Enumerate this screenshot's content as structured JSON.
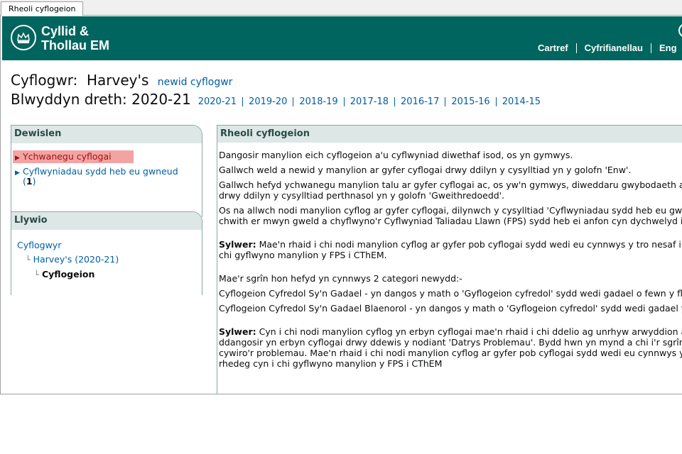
{
  "window": {
    "tab_title": "Rheoli cyflogeion"
  },
  "header": {
    "brand_line1": "Cyllid &",
    "brand_line2": "Thollau EM",
    "nav": [
      "Cartref",
      "Cyfrifianellau",
      "Eng"
    ]
  },
  "employer": {
    "label": "Cyflogwr:",
    "name": "Harvey's",
    "change_link": "newid cyflogwr"
  },
  "tax_year": {
    "label": "Blwyddyn dreth:",
    "current": "2020-21",
    "years": [
      "2020-21",
      "2019-20",
      "2018-19",
      "2017-18",
      "2016-17",
      "2015-16",
      "2014-15"
    ]
  },
  "menu": {
    "title": "Dewislen",
    "items": [
      {
        "label": "Ychwanegu cyflogai"
      },
      {
        "label": "Cyflwyniadau sydd heb eu gwneud",
        "count_open": "(",
        "count": "1",
        "count_close": ")"
      }
    ]
  },
  "navigation": {
    "title": "Llywio",
    "crumbs": [
      "Cyflogwyr",
      "Harvey's (2020-21)",
      "Cyflogeion"
    ]
  },
  "main": {
    "title": "Rheoli cyflogeion",
    "p1": "Dangosir manylion eich cyflogeion a'u cyflwyniad diwethaf isod, os yn gymwys.",
    "p2": "Gallwch weld a newid y manylion ar gyfer cyflogai drwy ddilyn y cysylltiad yn y golofn 'Enw'.",
    "p3a": "Gallwch hefyd ychwanegu manylion talu ar gyfer cyflogai ac, os yw'n gymwys, diweddaru gwybodaeth am",
    "p3b": "drwy ddilyn y cysylltiad perthnasol yn y golofn 'Gweithredoedd'.",
    "p4a": "Os na allwch nodi manylion cyflog ar gyfer cyflogai, dilynwch y cysylltiad 'Cyflwyniadau sydd heb eu gwneud'",
    "p4b": "chwith er mwyn gweld a chyflwyno'r Cyflwyniad Taliadau Llawn (FPS) sydd heb ei anfon cyn dychwelyd i",
    "note_label": "Sylwer:",
    "p5a": " Mae'n rhaid i chi nodi manylion cyflog ar gyfer pob cyflogai sydd wedi eu cynnwys y tro nesaf i'r",
    "p5b": "chi gyflwyno manylion y FPS i CThEM.",
    "p6": "Mae'r sgrîn hon hefyd yn cynnwys 2 categori newydd:-",
    "p7": "Cyflogeion Cyfredol Sy'n Gadael - yn dangos y math o 'Gyflogeion cyfredol' sydd wedi gadael o fewn y flw",
    "p8": "Cyflogeion Cyfredol Sy'n Gadael Blaenorol - yn dangos y math o 'Gyflogeion cyfredol' sydd wedi gadael y",
    "p9a": " Cyn i chi nodi manylion cyflog yn erbyn cyflogai mae'n rhaid i chi ddelio ag unrhyw arwyddion ar",
    "p9b": "ddangosir yn erbyn cyflogai drwy ddewis y nodiant 'Datrys Problemau'. Bydd hwn yn mynd a chi i'r sgrîn",
    "p9c": "cywiro'r problemau. Mae'n rhaid i chi nodi manylion cyflog ar gyfer pob cyflogai sydd wedi eu cynnwys y t",
    "p9d": "rhedeg cyn i chi gyflwyno manylion y FPS i CThEM"
  },
  "colors": {
    "header_bg": "#00655e",
    "link": "#005ea5",
    "panel_head_bg": "#dde7e6",
    "active_highlight": "#f4a3a3"
  },
  "icons": {
    "crest": "crown-crest-icon",
    "menu_arrow": "triangle-right-icon"
  }
}
